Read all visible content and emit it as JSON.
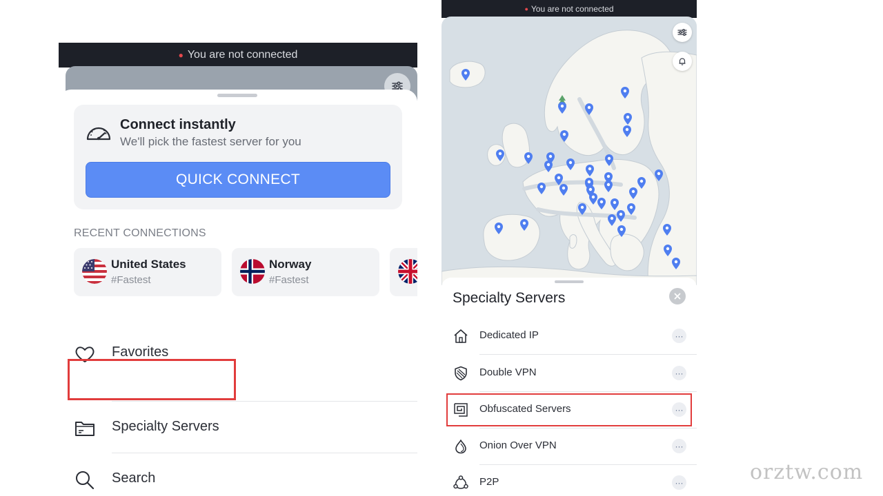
{
  "left_screen": {
    "status_text": "You are not connected",
    "connect_card": {
      "title": "Connect instantly",
      "subtitle": "We'll pick the fastest server for you",
      "button_label": "QUICK CONNECT"
    },
    "recent_heading": "RECENT CONNECTIONS",
    "recent_connections": [
      {
        "country": "United States",
        "tag": "#Fastest"
      },
      {
        "country": "Norway",
        "tag": "#Fastest"
      }
    ],
    "menu": [
      {
        "label": "Favorites",
        "icon": "heart-icon"
      },
      {
        "label": "Specialty Servers",
        "icon": "folder-icon"
      },
      {
        "label": "Search",
        "icon": "search-icon"
      }
    ]
  },
  "right_screen": {
    "status_text": "You are not connected",
    "sheet_title": "Specialty Servers",
    "items": [
      {
        "label": "Dedicated IP",
        "icon": "home-icon"
      },
      {
        "label": "Double VPN",
        "icon": "shield-icon"
      },
      {
        "label": "Obfuscated Servers",
        "icon": "obfuscated-icon"
      },
      {
        "label": "Onion Over VPN",
        "icon": "onion-icon"
      },
      {
        "label": "P2P",
        "icon": "p2p-icon"
      }
    ],
    "more_glyph": "···"
  },
  "colors": {
    "accent_blue": "#5b8cf5",
    "status_bar": "#1d2028",
    "highlight_red": "#e13c3c",
    "map_land": "#f5f5f1",
    "map_water": "#d7dfe5",
    "pin_blue": "#4f7ef0"
  },
  "watermark": "orztw.com"
}
